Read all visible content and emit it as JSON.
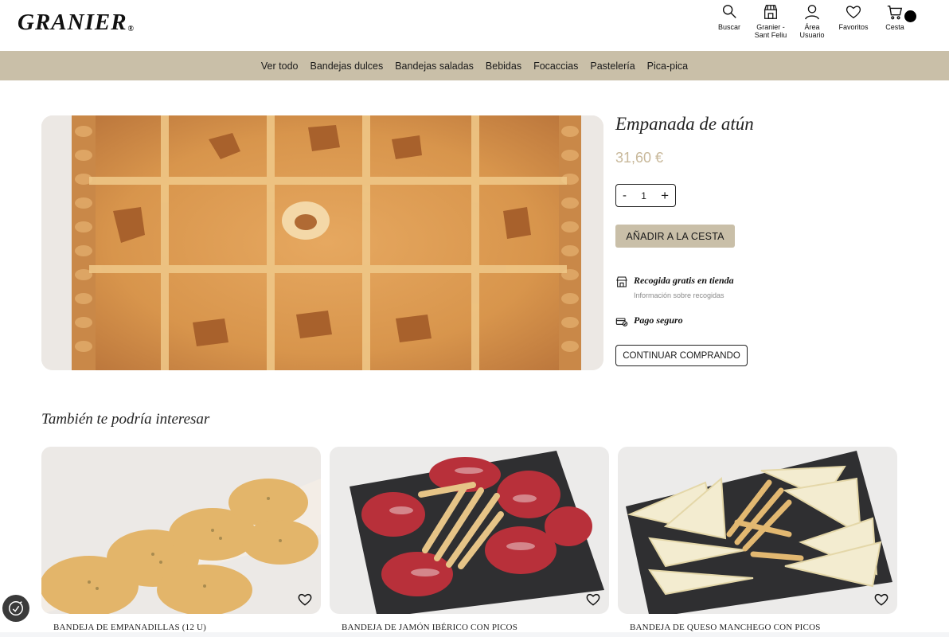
{
  "header": {
    "logo": "GRANIER",
    "logo_mark": "®",
    "icons": [
      {
        "label": "Buscar",
        "icon": "search-icon"
      },
      {
        "label": "Granier - Sant Feliu",
        "icon": "store-icon"
      },
      {
        "label": "Área Usuario",
        "icon": "user-icon"
      },
      {
        "label": "Favoritos",
        "icon": "heart-icon"
      },
      {
        "label": "Cesta",
        "icon": "cart-icon"
      }
    ]
  },
  "nav": [
    "Ver todo",
    "Bandejas dulces",
    "Bandejas saladas",
    "Bebidas",
    "Focaccias",
    "Pastelería",
    "Pica-pica"
  ],
  "product": {
    "title": "Empanada de atún",
    "price": "31,60 €",
    "qty_minus": "-",
    "qty_value": "1",
    "qty_plus": "+",
    "add_button": "AÑADIR A LA CESTA",
    "pickup_title": "Recogida gratis en tienda",
    "pickup_sub": "Información sobre recogidas",
    "payment_title": "Pago seguro",
    "continue_button": "CONTINUAR COMPRANDO"
  },
  "related": {
    "title": "También te podría interesar",
    "items": [
      {
        "name": "BANDEJA DE EMPANADILLAS (12 U)"
      },
      {
        "name": "BANDEJA DE JAMÓN IBÉRICO CON PICOS"
      },
      {
        "name": "BANDEJA DE QUESO MANCHEGO CON PICOS"
      }
    ]
  },
  "colors": {
    "accent": "#c9bfa8",
    "price": "#c8b89a",
    "text": "#1a1a1a"
  }
}
